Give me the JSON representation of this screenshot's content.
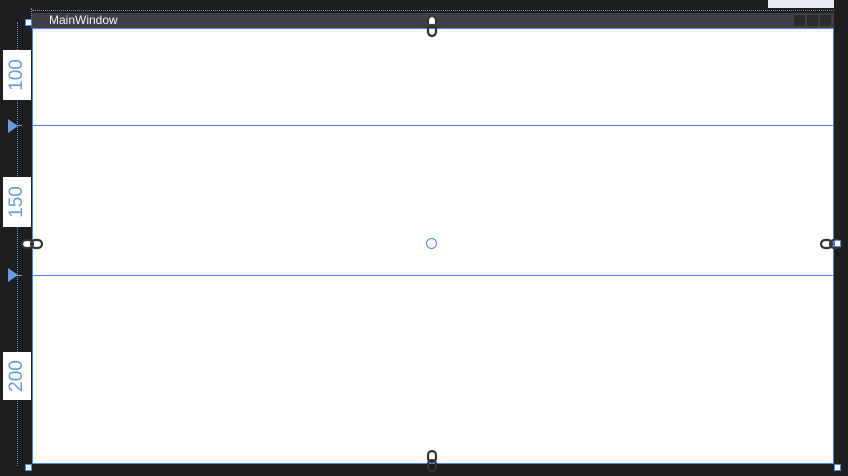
{
  "window": {
    "title": "MainWindow"
  },
  "rows": [
    {
      "height_label": "100"
    },
    {
      "height_label": "150"
    },
    {
      "height_label": "200"
    }
  ],
  "icons": {
    "anchor": "chain-link-icon",
    "center": "circle-icon",
    "row_marker": "triangle-marker-icon"
  },
  "colors": {
    "accent": "#4a86e8",
    "label_text": "#6a9be0",
    "background": "#1e1e1e",
    "titlebar": "#3f3f46"
  }
}
